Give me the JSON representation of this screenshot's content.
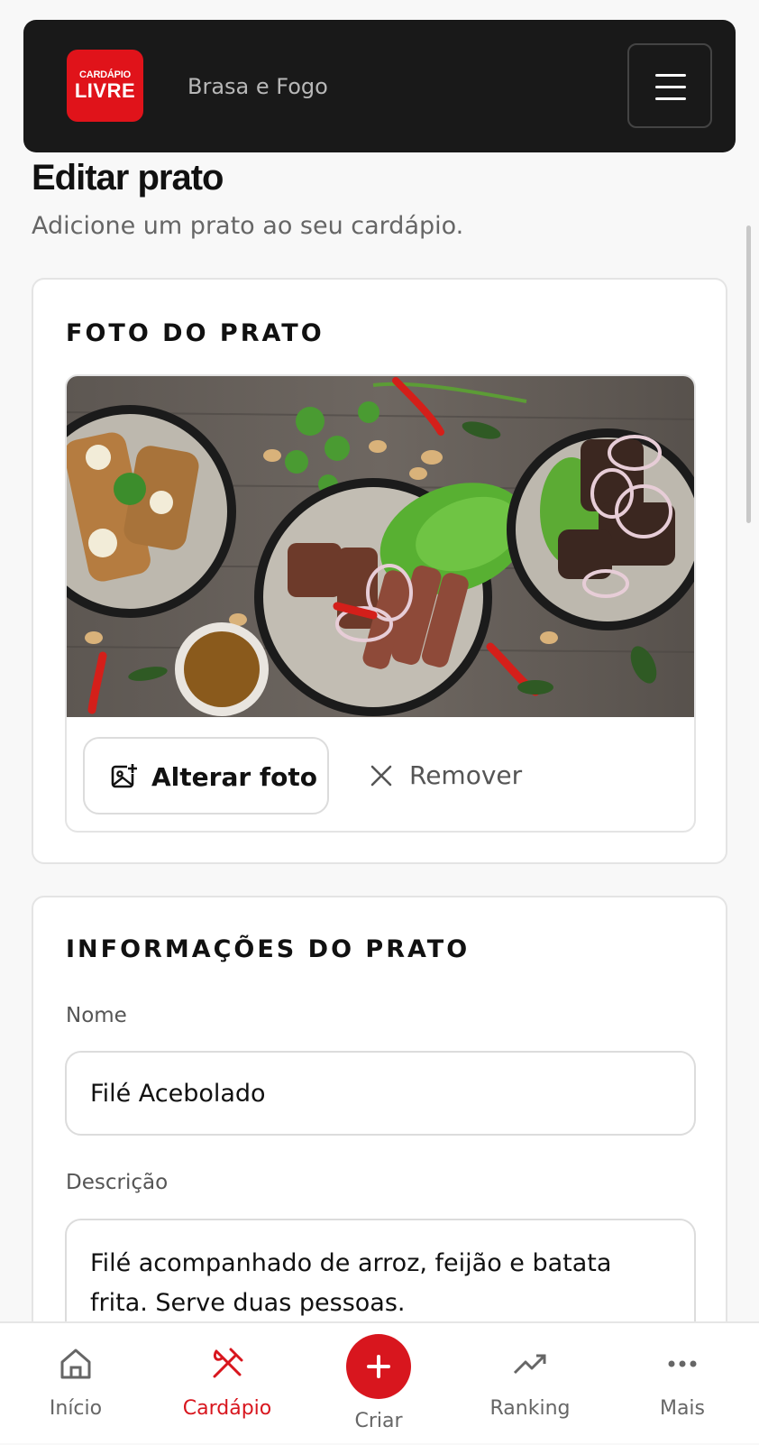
{
  "header": {
    "logo_line1": "CARDÁPIO",
    "logo_line2": "LIVRE",
    "restaurant_name": "Brasa e Fogo",
    "menu_icon": "hamburger-menu-icon"
  },
  "page": {
    "title": "Editar prato",
    "subtitle": "Adicione um prato ao seu cardápio."
  },
  "photo_card": {
    "title": "FOTO DO PRATO",
    "change_label": "Alterar foto",
    "change_icon": "image-plus-icon",
    "remove_label": "Remover",
    "remove_icon": "close-icon"
  },
  "info_card": {
    "title": "INFORMAÇÕES DO PRATO",
    "name_label": "Nome",
    "name_value": "Filé Acebolado",
    "description_label": "Descrição",
    "description_value": "Filé acompanhado de arroz, feijão e batata frita. Serve duas pessoas."
  },
  "bottom_nav": {
    "items": [
      {
        "label": "Início",
        "icon": "home-icon"
      },
      {
        "label": "Cardápio",
        "icon": "fork-knife-icon",
        "active": true
      },
      {
        "label": "Criar",
        "icon": "plus-icon"
      },
      {
        "label": "Ranking",
        "icon": "trending-up-icon"
      },
      {
        "label": "Mais",
        "icon": "more-horizontal-icon"
      }
    ]
  },
  "colors": {
    "accent": "#d8161e",
    "header_bg": "#191919",
    "background": "#f8f8f8"
  }
}
